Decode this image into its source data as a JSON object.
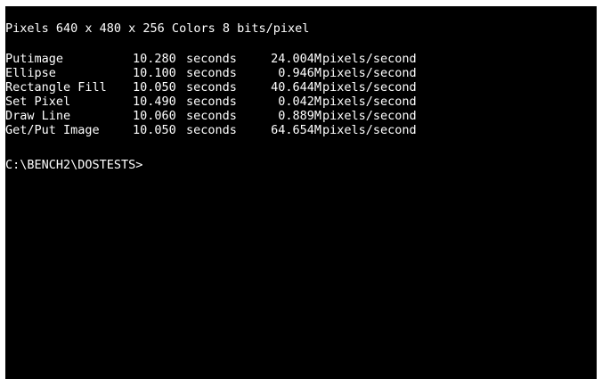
{
  "header": "Pixels 640 x 480 x 256 Colors 8 bits/pixel",
  "results": [
    {
      "test": "Putimage",
      "time": "10.280",
      "time_unit": "seconds",
      "rate": "24.004M",
      "rate_unit": "pixels/second"
    },
    {
      "test": "Ellipse",
      "time": "10.100",
      "time_unit": "seconds",
      "rate": "0.946M",
      "rate_unit": "pixels/second"
    },
    {
      "test": "Rectangle Fill",
      "time": "10.050",
      "time_unit": "seconds",
      "rate": "40.644M",
      "rate_unit": "pixels/second"
    },
    {
      "test": "Set Pixel",
      "time": "10.490",
      "time_unit": "seconds",
      "rate": "0.042M",
      "rate_unit": "pixels/second"
    },
    {
      "test": "Draw Line",
      "time": "10.060",
      "time_unit": "seconds",
      "rate": "0.889M",
      "rate_unit": "pixels/second"
    },
    {
      "test": "Get/Put Image",
      "time": "10.050",
      "time_unit": "seconds",
      "rate": "64.654M",
      "rate_unit": "pixels/second"
    }
  ],
  "prompt": "C:\\BENCH2\\DOSTESTS>",
  "colors": {
    "background": "#000000",
    "text": "#ffffff"
  }
}
